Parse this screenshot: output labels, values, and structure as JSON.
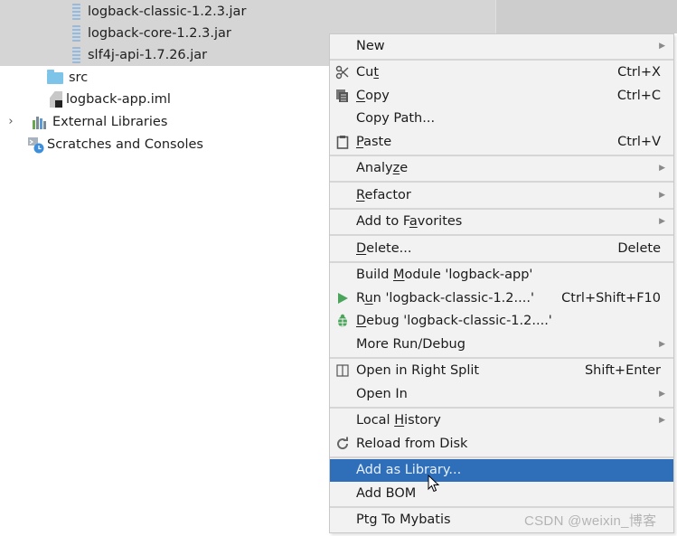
{
  "project_tree": {
    "items": [
      {
        "label": "logback-classic-1.2.3.jar",
        "icon": "jar-icon",
        "selected": true
      },
      {
        "label": "logback-core-1.2.3.jar",
        "icon": "jar-icon",
        "selected": true
      },
      {
        "label": "slf4j-api-1.7.26.jar",
        "icon": "jar-icon",
        "selected": true
      },
      {
        "label": "src",
        "icon": "folder-icon",
        "selected": false
      },
      {
        "label": "logback-app.iml",
        "icon": "iml-file-icon",
        "selected": false
      },
      {
        "label": "External Libraries",
        "icon": "libraries-icon",
        "expander": "›",
        "selected": false
      },
      {
        "label": "Scratches and Consoles",
        "icon": "scratches-icon",
        "selected": false
      }
    ]
  },
  "context_menu": {
    "groups": [
      [
        {
          "label": "New",
          "submenu": true
        }
      ],
      [
        {
          "label": "Cut",
          "mnemonic_index": 2,
          "shortcut": "Ctrl+X",
          "icon": "scissors-icon"
        },
        {
          "label": "Copy",
          "mnemonic_index": 0,
          "shortcut": "Ctrl+C",
          "icon": "copy-icon"
        },
        {
          "label": "Copy Path...",
          "mnemonic_index": -1
        },
        {
          "label": "Paste",
          "mnemonic_index": 0,
          "shortcut": "Ctrl+V",
          "icon": "clipboard-icon"
        }
      ],
      [
        {
          "label": "Analyze",
          "mnemonic_index": 5,
          "submenu": true
        }
      ],
      [
        {
          "label": "Refactor",
          "mnemonic_index": 0,
          "submenu": true
        }
      ],
      [
        {
          "label": "Add to Favorites",
          "mnemonic_index": 8,
          "submenu": true
        }
      ],
      [
        {
          "label": "Delete...",
          "mnemonic_index": 0,
          "shortcut": "Delete"
        }
      ],
      [
        {
          "label": "Build Module 'logback-app'",
          "mnemonic_index": 6
        },
        {
          "label": "Run 'logback-classic-1.2....'",
          "mnemonic_index": 1,
          "shortcut": "Ctrl+Shift+F10",
          "icon": "run-icon"
        },
        {
          "label": "Debug 'logback-classic-1.2....'",
          "mnemonic_index": 0,
          "icon": "debug-icon"
        },
        {
          "label": "More Run/Debug",
          "submenu": true
        }
      ],
      [
        {
          "label": "Open in Right Split",
          "shortcut": "Shift+Enter",
          "icon": "split-icon"
        },
        {
          "label": "Open In",
          "submenu": true
        }
      ],
      [
        {
          "label": "Local History",
          "mnemonic_index": 6,
          "submenu": true
        },
        {
          "label": "Reload from Disk",
          "icon": "reload-icon"
        }
      ],
      [
        {
          "label": "Add as Library...",
          "active": true
        },
        {
          "label": "Add BOM"
        }
      ],
      [
        {
          "label": "Ptg To Mybatis"
        }
      ]
    ]
  },
  "colors": {
    "selection": "#2f6fba",
    "run_green": "#4aa55a",
    "debug_green": "#4aa55a",
    "tree_selection": "#d5d5d5"
  },
  "watermark": "CSDN @weixin_博客"
}
